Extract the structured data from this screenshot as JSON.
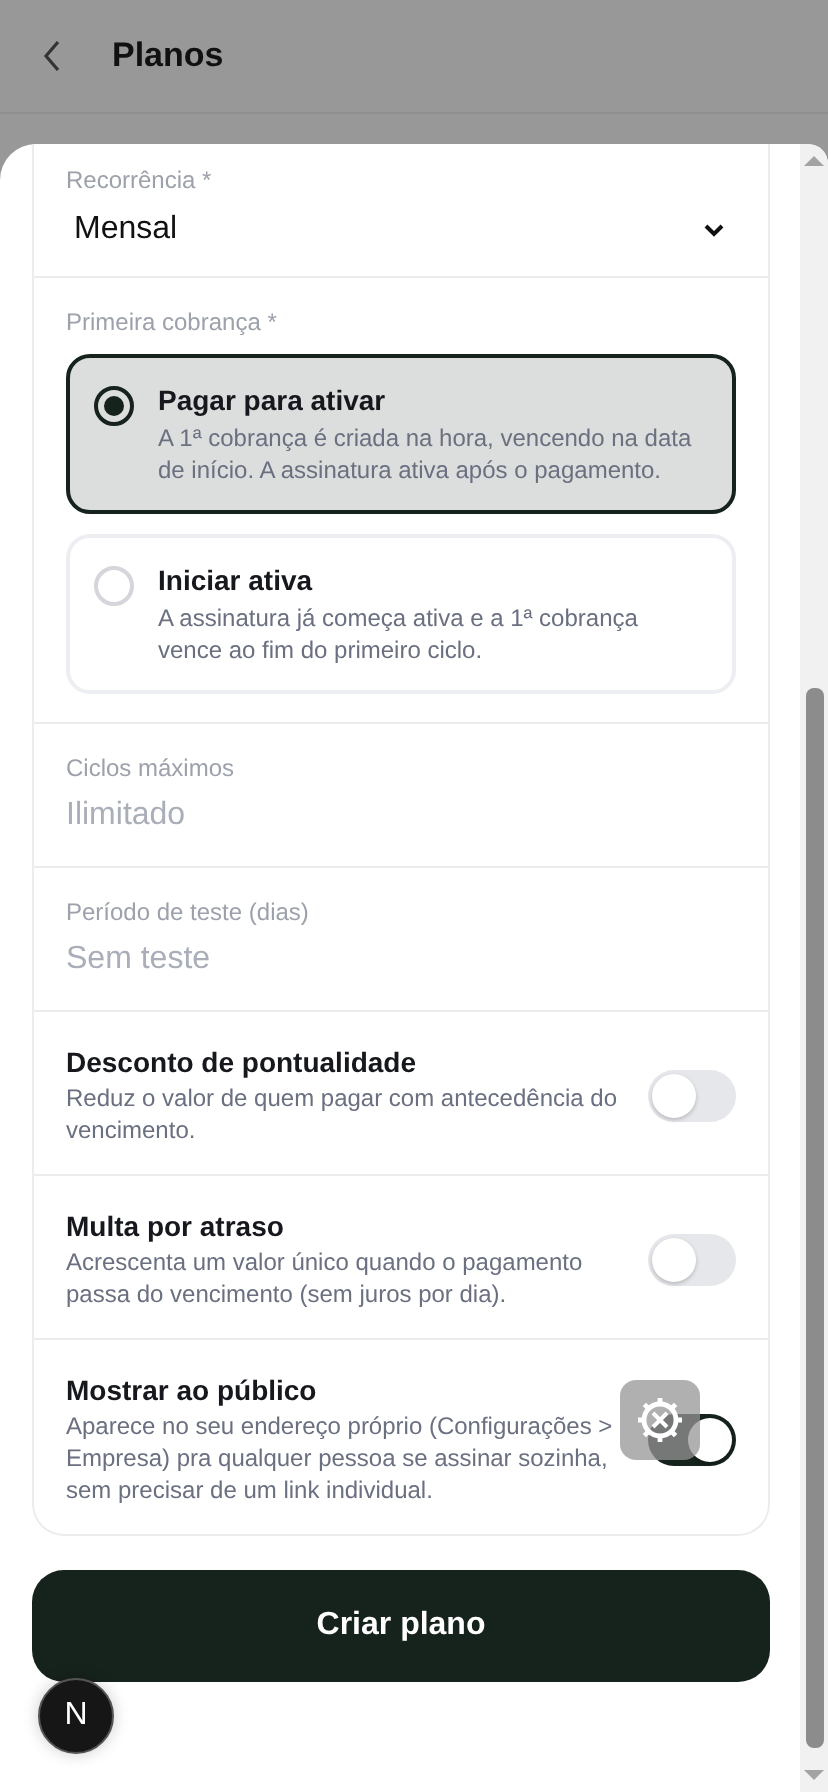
{
  "header": {
    "title": "Planos"
  },
  "form": {
    "fields": [
      {
        "kind": "select",
        "label": "Recorrência *",
        "value": "Mensal"
      },
      {
        "kind": "radio",
        "label": "Primeira cobrança *",
        "options": [
          {
            "title": "Pagar para ativar",
            "description": "A 1ª cobrança é criada na hora, vencendo na data de início. A assinatura ativa após o pagamento.",
            "selected": true
          },
          {
            "title": "Iniciar ativa",
            "description": "A assinatura já começa ativa e a 1ª cobrança vence ao fim do primeiro ciclo.",
            "selected": false
          }
        ]
      },
      {
        "kind": "input",
        "label": "Ciclos máximos",
        "placeholder": "Ilimitado"
      },
      {
        "kind": "input",
        "label": "Período de teste (dias)",
        "placeholder": "Sem teste"
      },
      {
        "kind": "toggle",
        "title": "Desconto de pontualidade",
        "description": "Reduz o valor de quem pagar com antecedência do vencimento.",
        "on": false
      },
      {
        "kind": "toggle",
        "title": "Multa por atraso",
        "description": "Acrescenta um valor único quando o pagamento passa do vencimento (sem juros por dia).",
        "on": false
      },
      {
        "kind": "toggle",
        "title": "Mostrar ao público",
        "description": "Aparece no seu endereço próprio (Configurações > Empresa) pra qualquer pessoa se assinar sozinha, sem precisar de um link individual.",
        "on": true
      }
    ]
  },
  "submit_button": "Criar plano",
  "dev_badge": "N"
}
